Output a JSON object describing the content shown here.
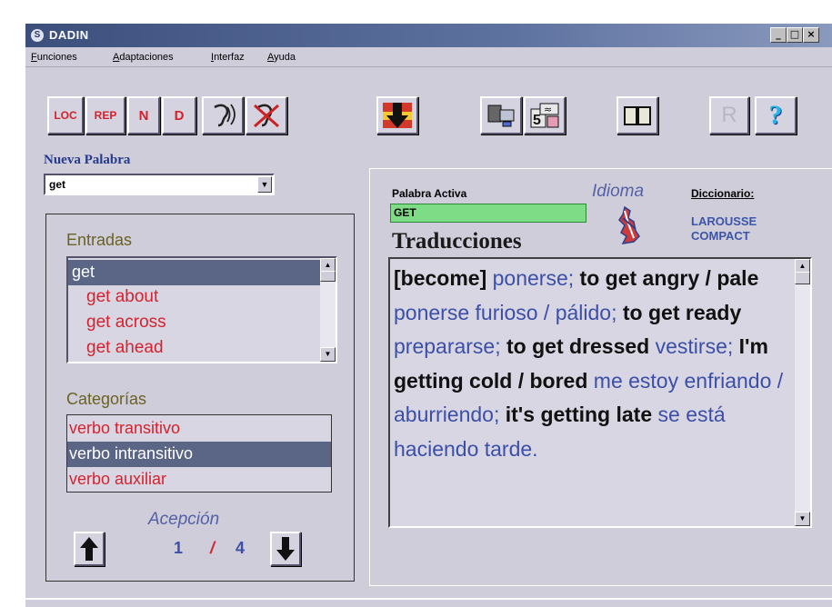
{
  "window": {
    "title": "DADIN"
  },
  "menu": {
    "items": [
      "Funciones",
      "Adaptaciones",
      "Interfaz",
      "Ayuda"
    ]
  },
  "toolbar": {
    "loc_label": "LOC",
    "rep_label": "REP",
    "n_label": "N",
    "d_label": "D",
    "r_label": "R",
    "help_label": "?"
  },
  "nueva_palabra": {
    "label": "Nueva Palabra",
    "value": "get"
  },
  "entradas": {
    "title": "Entradas",
    "items": [
      "get",
      "get about",
      "get across",
      "get ahead"
    ],
    "selected_index": 0
  },
  "categorias": {
    "title": "Categorías",
    "items": [
      "verbo transitivo",
      "verbo intransitivo",
      "verbo auxiliar"
    ],
    "selected_index": 1
  },
  "acepcion": {
    "label": "Acepción",
    "current": "1",
    "separator": "/",
    "total": "4"
  },
  "palabra_activa": {
    "label": "Palabra Activa",
    "value": "GET"
  },
  "idioma": {
    "label": "Idioma"
  },
  "diccionario": {
    "label": "Diccionario:",
    "line1": "LAROUSSE",
    "line2": "COMPACT"
  },
  "traducciones": {
    "title": "Traducciones",
    "segments": [
      {
        "t": "[become] ",
        "k": "en"
      },
      {
        "t": "ponerse; ",
        "k": "es"
      },
      {
        "t": "to get angry / pale ",
        "k": "en"
      },
      {
        "t": "ponerse furioso / pálido; ",
        "k": "es"
      },
      {
        "t": "to get ready ",
        "k": "en"
      },
      {
        "t": "prepararse; ",
        "k": "es"
      },
      {
        "t": "to get dressed ",
        "k": "en"
      },
      {
        "t": "vestirse; ",
        "k": "es"
      },
      {
        "t": "I'm getting cold / bored ",
        "k": "en"
      },
      {
        "t": "me estoy enfriando / aburriendo; ",
        "k": "es"
      },
      {
        "t": "it's getting late ",
        "k": "en"
      },
      {
        "t": "se está haciendo tarde.",
        "k": "es"
      }
    ]
  },
  "colors": {
    "title_bar": "#3c4f7c",
    "window_bg": "#cfcdda",
    "selection": "#5b6687",
    "red_text": "#d4232e",
    "blue_text": "#3c4fa8",
    "active_word_bg": "#7fdc86"
  }
}
